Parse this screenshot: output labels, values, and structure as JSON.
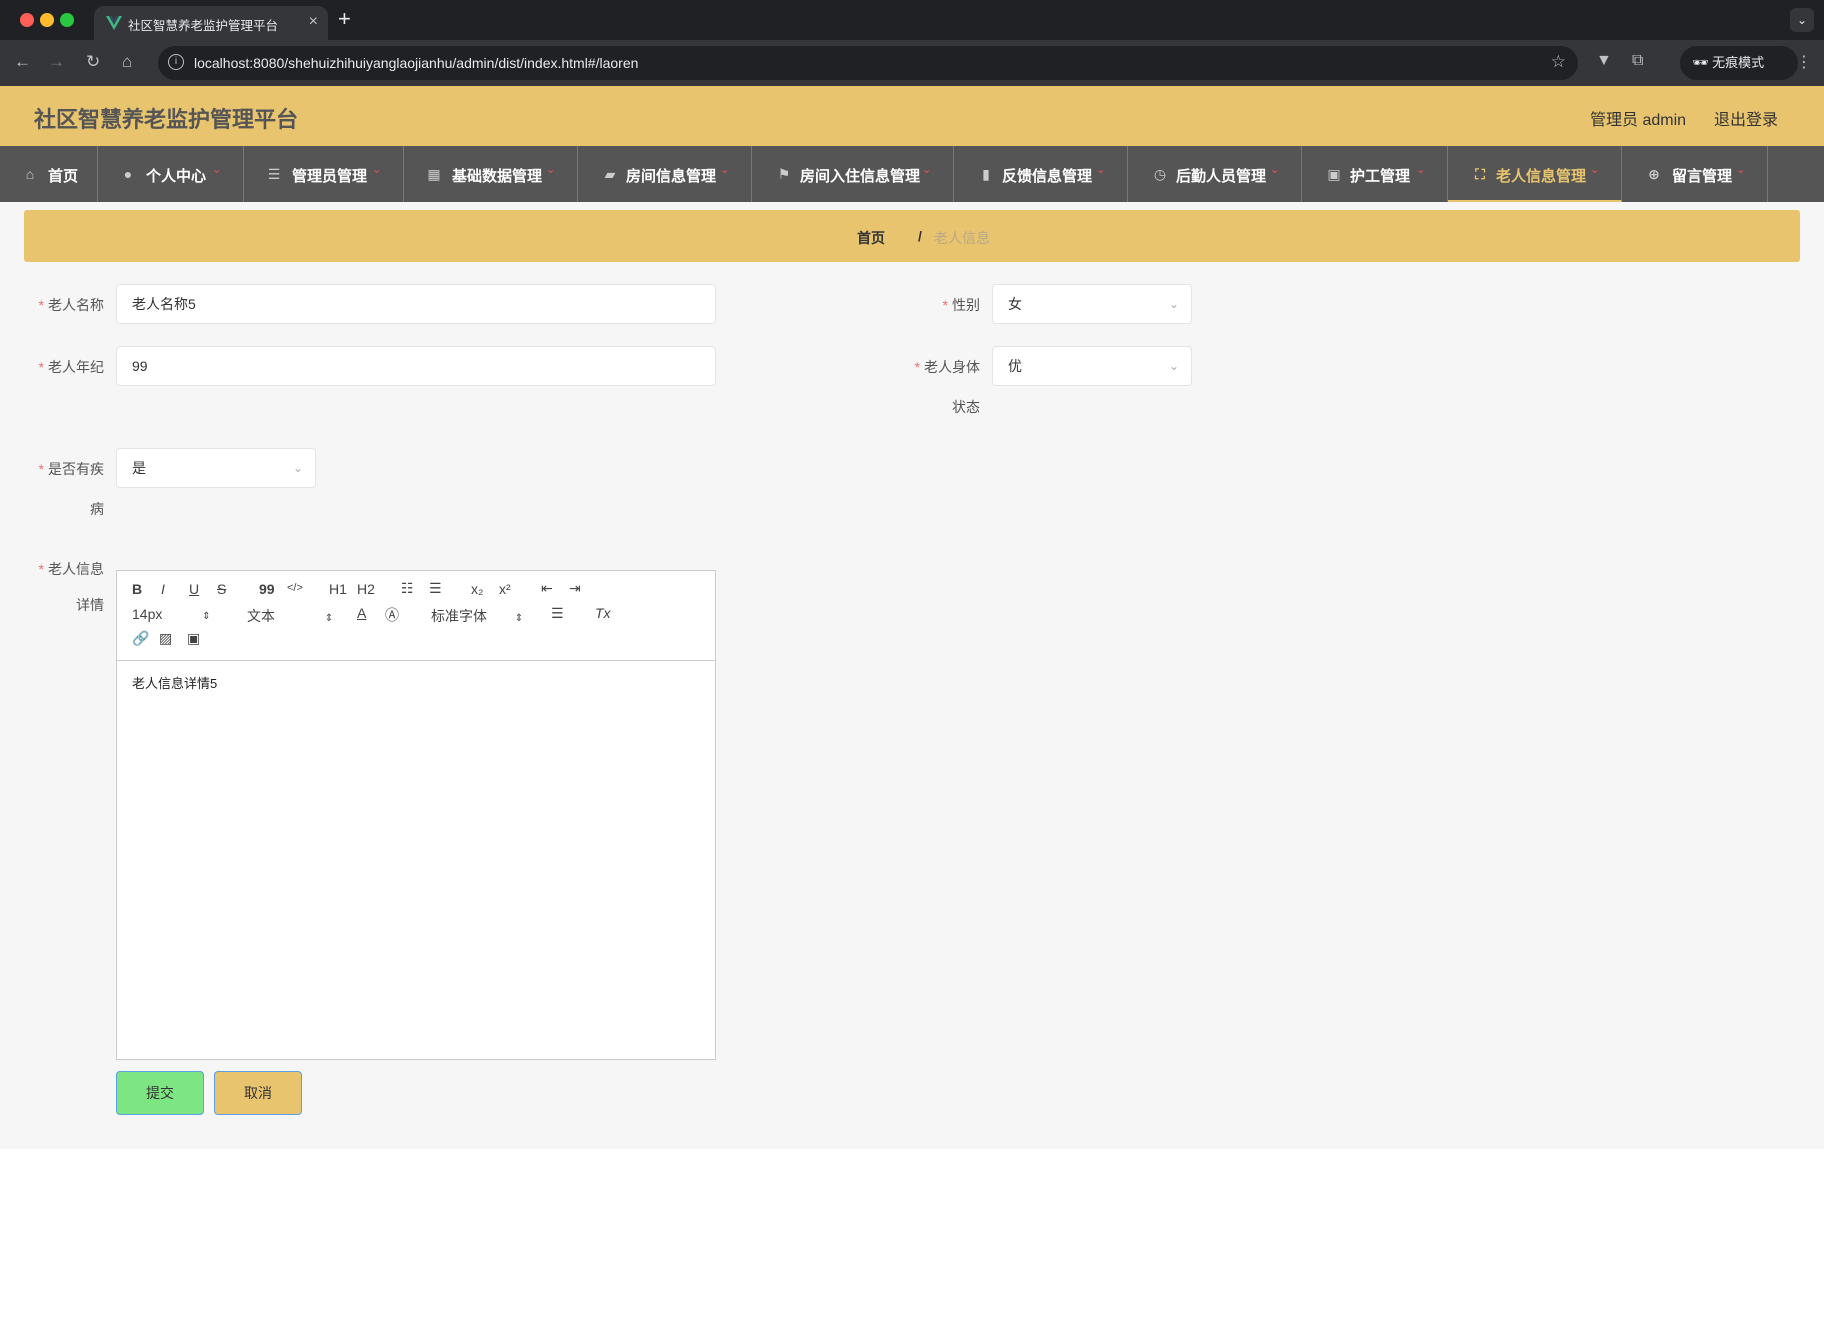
{
  "browser": {
    "tab_title": "社区智慧养老监护管理平台",
    "url": "localhost:8080/shehuizhihuiyanglaojianhu/admin/dist/index.html#/laoren",
    "incognito_label": "无痕模式",
    "colors": {
      "red": "#ff5f57",
      "yellow": "#febc2e",
      "green": "#28c840"
    }
  },
  "header": {
    "title": "社区智慧养老监护管理平台",
    "user": "管理员 admin",
    "logout": "退出登录",
    "accent_color": "#e8c46e"
  },
  "menu": {
    "items": [
      {
        "label": "首页",
        "icon": "home-icon"
      },
      {
        "label": "个人中心",
        "icon": "user-icon"
      },
      {
        "label": "管理员管理",
        "icon": "list-icon"
      },
      {
        "label": "基础数据管理",
        "icon": "grid-icon"
      },
      {
        "label": "房间信息管理",
        "icon": "folder-icon"
      },
      {
        "label": "房间入住信息管理",
        "icon": "flag-icon"
      },
      {
        "label": "反馈信息管理",
        "icon": "bar-chart-icon"
      },
      {
        "label": "后勤人员管理",
        "icon": "clock-icon"
      },
      {
        "label": "护工管理",
        "icon": "chart-icon"
      },
      {
        "label": "老人信息管理",
        "icon": "fullscreen-icon",
        "active": true
      },
      {
        "label": "留言管理",
        "icon": "target-icon"
      }
    ]
  },
  "breadcrumb": {
    "home": "首页",
    "separator": "/",
    "current": "老人信息"
  },
  "form": {
    "name_label": "老人名称",
    "name_value": "老人名称5",
    "gender_label": "性别",
    "gender_value": "女",
    "age_label": "老人年纪",
    "age_value": "99",
    "health_label_1": "老人身体",
    "health_label_2": "状态",
    "health_value": "优",
    "disease_label_1": "是否有疾",
    "disease_label_2": "病",
    "disease_value": "是",
    "detail_label_1": "老人信息",
    "detail_label_2": "详情",
    "detail_value": "老人信息详情5",
    "required_mark": "*"
  },
  "editor_toolbar": {
    "bold": "B",
    "italic": "I",
    "underline": "U",
    "strike": "S",
    "quote": "99",
    "code": "</>",
    "h1": "H1",
    "h2": "H2",
    "subscript": "x₂",
    "superscript": "x²",
    "size": "14px",
    "header_type": "文本",
    "font": "标准字体"
  },
  "buttons": {
    "submit": "提交",
    "cancel": "取消"
  }
}
